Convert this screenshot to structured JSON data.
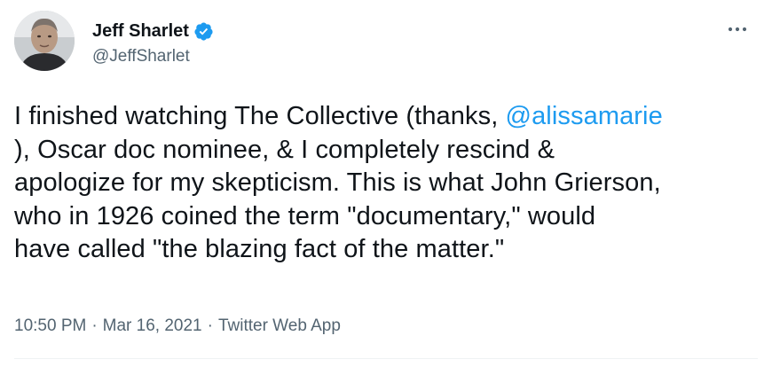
{
  "author": {
    "name": "Jeff Sharlet",
    "handle": "@JeffSharlet"
  },
  "tweet": {
    "text_lines": [
      {
        "before": "I finished watching The Collective (thanks, ",
        "mention": "@alissamarie"
      },
      {
        "text": "), Oscar doc nominee, & I completely rescind &"
      },
      {
        "text": "apologize for my skepticism. This is what John Grierson,"
      },
      {
        "text": "who in 1926 coined the term \"documentary,\" would"
      },
      {
        "text": "have called \"the blazing fact of the matter.\""
      }
    ]
  },
  "meta": {
    "time": "10:50 PM",
    "separator": "·",
    "date": "Mar 16, 2021",
    "source": "Twitter Web App"
  },
  "icons": {
    "verified": "verified-badge-icon",
    "more": "more-options-icon"
  },
  "colors": {
    "mention": "#1d9bf0",
    "verified": "#1d9bf0",
    "secondary_text": "#536471"
  }
}
